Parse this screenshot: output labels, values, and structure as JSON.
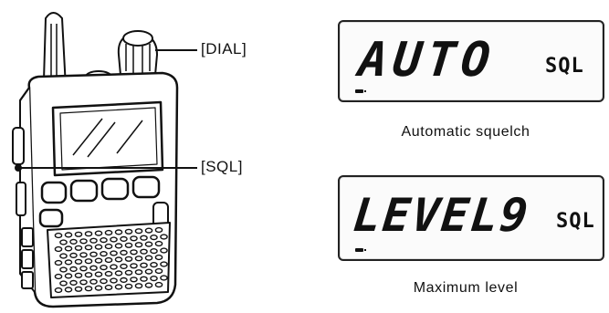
{
  "callouts": {
    "dial": "[DIAL]",
    "sql": "[SQL]"
  },
  "displays": [
    {
      "main": "AUTO",
      "indicator": "SQL",
      "caption": "Automatic squelch"
    },
    {
      "main": "LEVEL9",
      "indicator": "SQL",
      "caption": "Maximum level"
    }
  ]
}
